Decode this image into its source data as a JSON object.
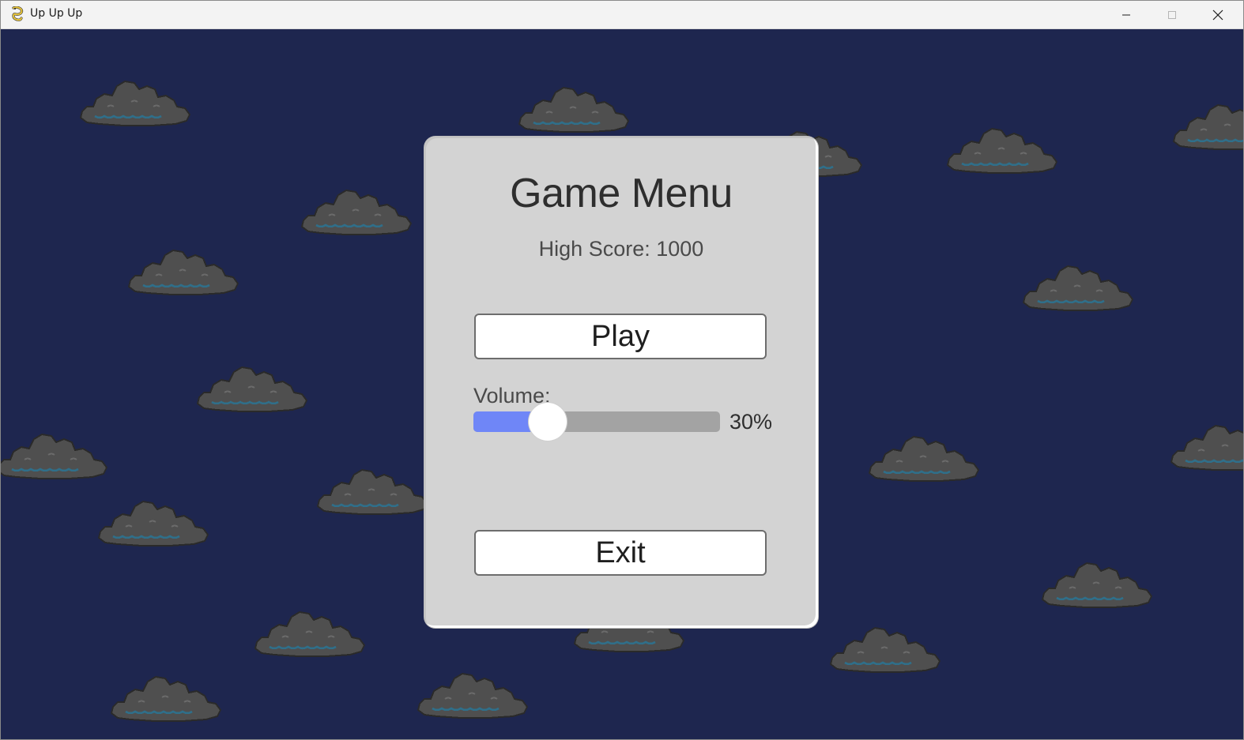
{
  "window": {
    "title": "Up Up Up",
    "app_icon": "pygame-snake-icon",
    "controls": [
      "minimize-icon",
      "maximize-icon",
      "close-icon"
    ]
  },
  "scene": {
    "background_color": "#1e264f",
    "cloud_color": "#4f4f4f",
    "cloud_outline": "#2a2a2a",
    "cloud_accent": "#2f6f8a"
  },
  "menu": {
    "title": "Game Menu",
    "high_score": "High Score: 1000",
    "play_label": "Play",
    "volume_label": "Volume:",
    "volume_value": 0.3,
    "volume_text": "30%",
    "exit_label": "Exit",
    "panel_color": "#d3d3d3",
    "slider_fill_color": "#6f86f7"
  }
}
